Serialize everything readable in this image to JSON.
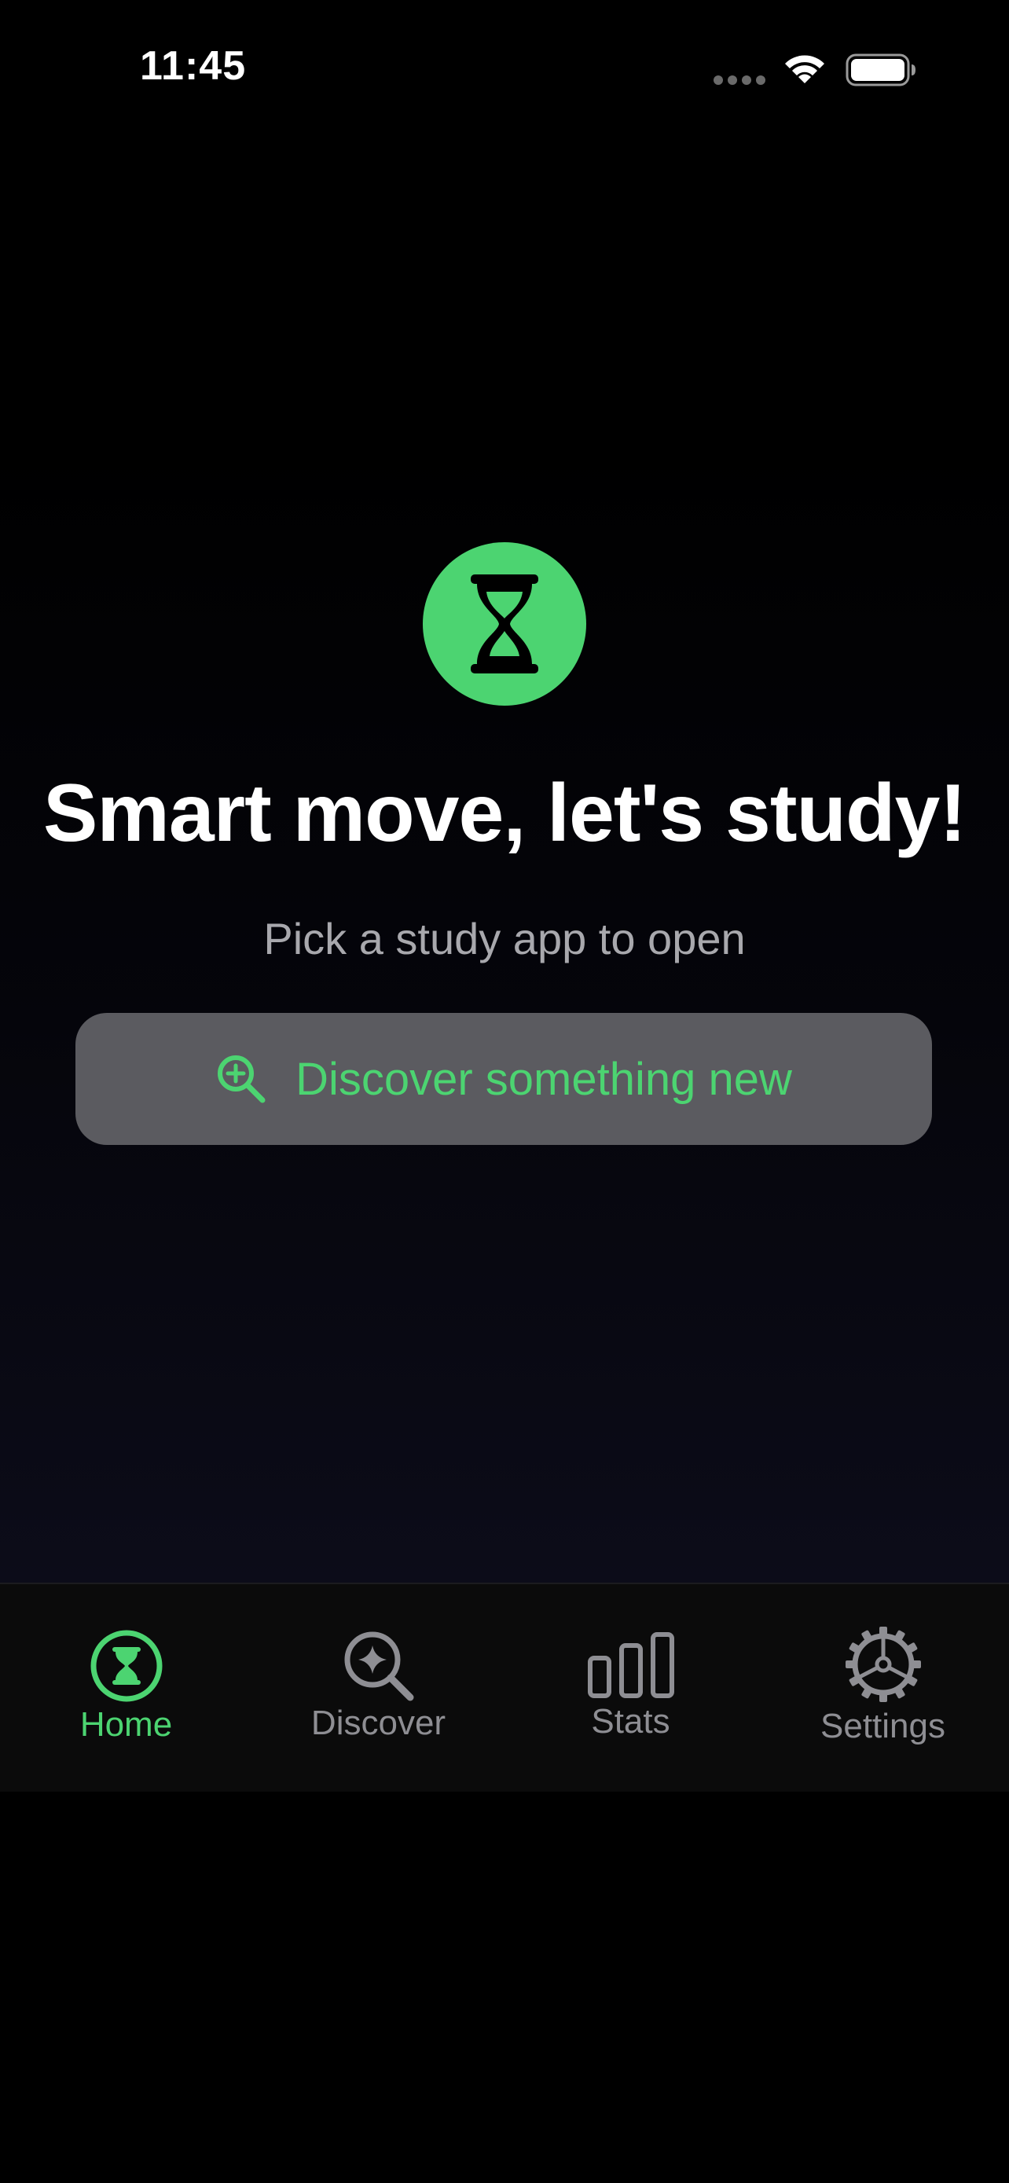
{
  "status_bar": {
    "time": "11:45"
  },
  "hero": {
    "icon": "hourglass-icon",
    "title": "Smart move, let's study!",
    "subtitle": "Pick a study app to open"
  },
  "discover_button": {
    "icon": "magnifier-plus-icon",
    "label": "Discover something new"
  },
  "tab_bar": {
    "tabs": [
      {
        "label": "Home",
        "icon": "hourglass-circle-icon",
        "active": true
      },
      {
        "label": "Discover",
        "icon": "sparkle-magnifier-icon",
        "active": false
      },
      {
        "label": "Stats",
        "icon": "bar-chart-icon",
        "active": false
      },
      {
        "label": "Settings",
        "icon": "gear-icon",
        "active": false
      }
    ]
  },
  "colors": {
    "accent": "#4cd471",
    "background": "#000000",
    "button_bg": "#5b5b60",
    "muted_text": "#a8a8ad",
    "inactive_tab": "#8e8e93"
  }
}
